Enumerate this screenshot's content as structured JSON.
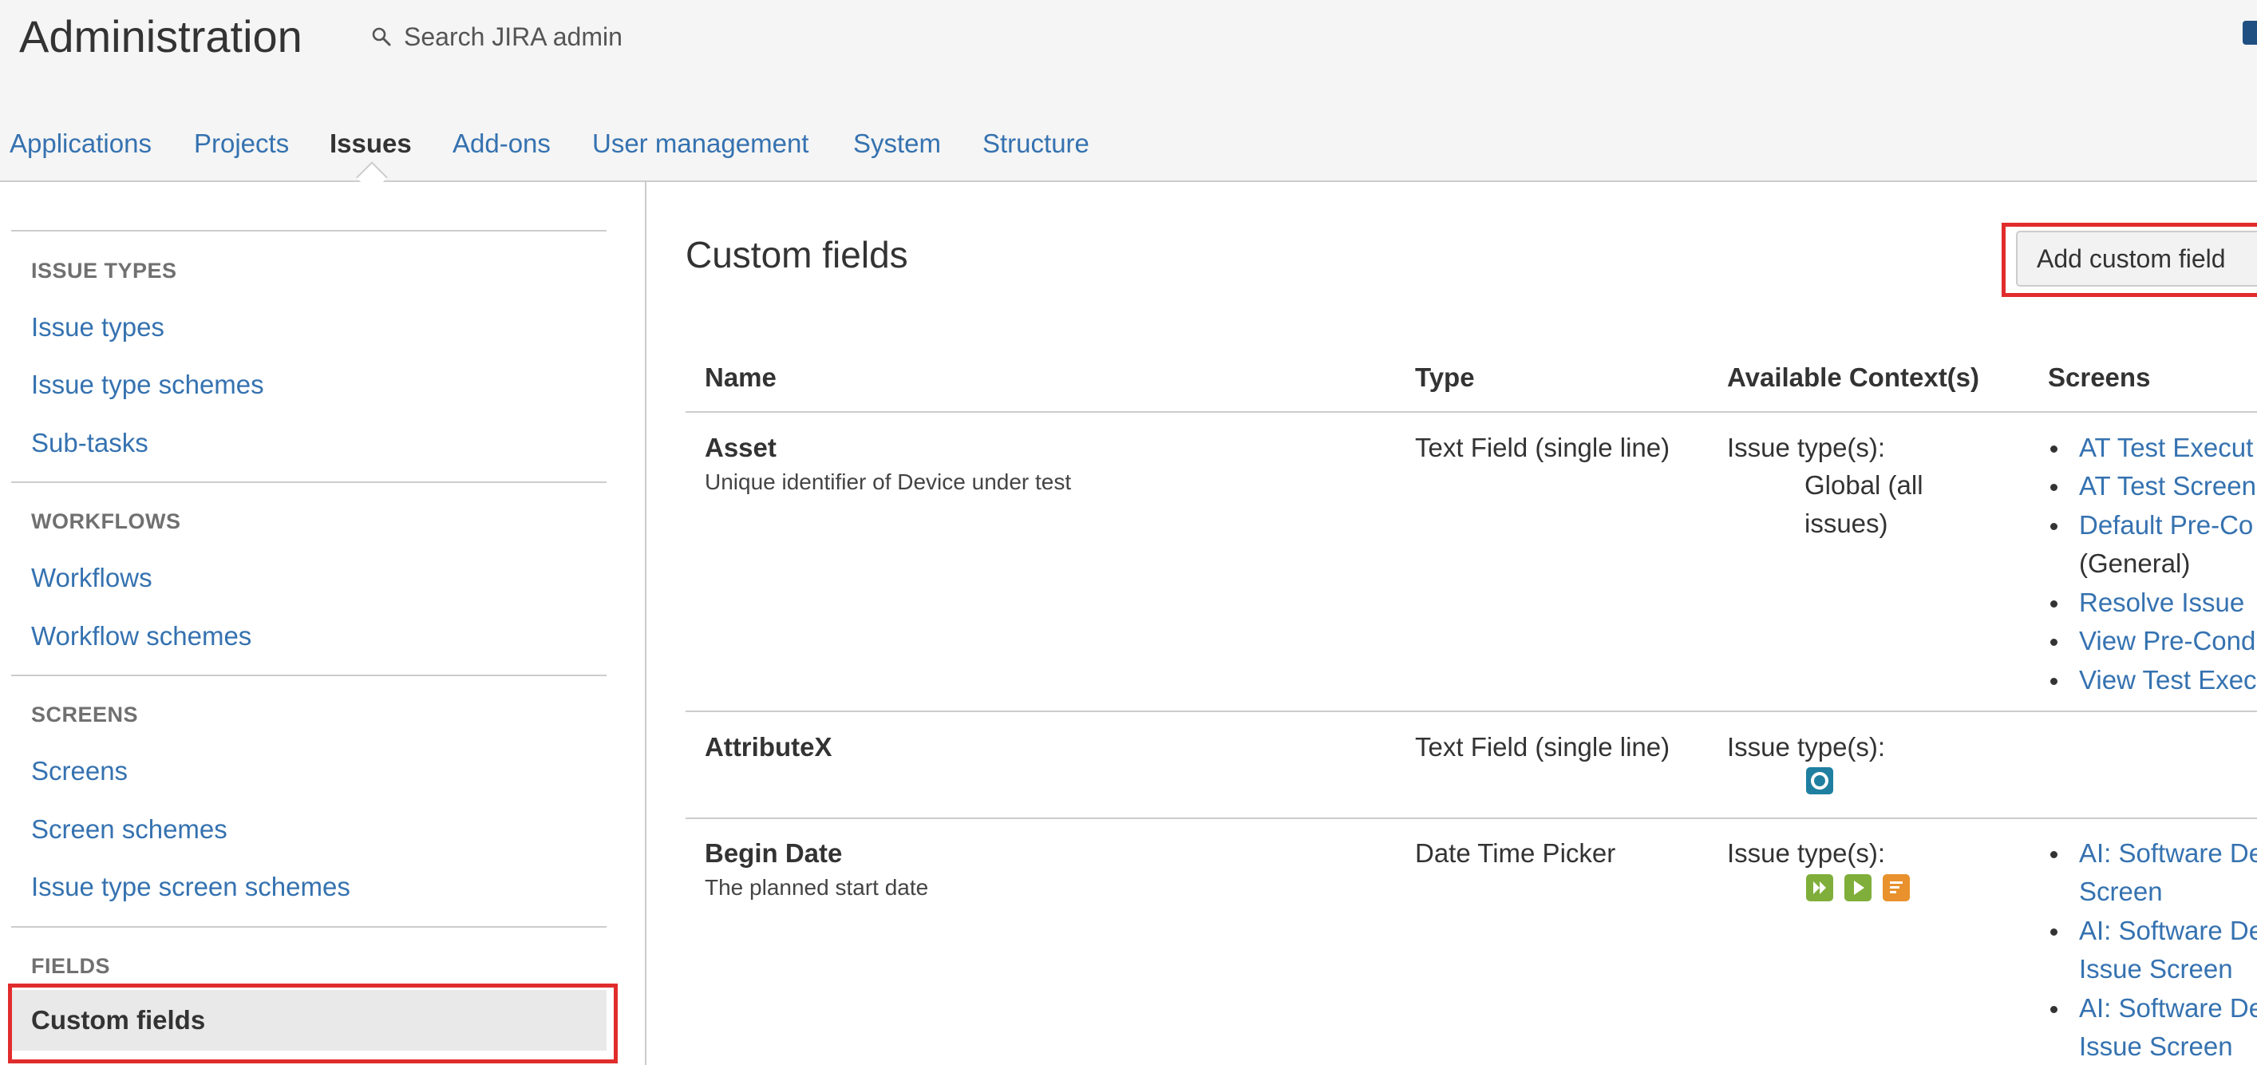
{
  "header": {
    "title": "Administration",
    "search_placeholder": "Search JIRA admin"
  },
  "nav": {
    "tabs": [
      "Applications",
      "Projects",
      "Issues",
      "Add-ons",
      "User management",
      "System",
      "Structure"
    ],
    "active": "Issues"
  },
  "sidebar": {
    "sections": [
      {
        "heading": "ISSUE TYPES",
        "items": [
          "Issue types",
          "Issue type schemes",
          "Sub-tasks"
        ]
      },
      {
        "heading": "WORKFLOWS",
        "items": [
          "Workflows",
          "Workflow schemes"
        ]
      },
      {
        "heading": "SCREENS",
        "items": [
          "Screens",
          "Screen schemes",
          "Issue type screen schemes"
        ]
      },
      {
        "heading": "FIELDS",
        "items": [
          "Custom fields"
        ]
      }
    ],
    "selected": "Custom fields"
  },
  "main": {
    "title": "Custom fields",
    "add_button": "Add custom field",
    "columns": [
      "Name",
      "Type",
      "Available Context(s)",
      "Screens"
    ],
    "rows": [
      {
        "name": "Asset",
        "description": "Unique identifier of Device under test",
        "type": "Text Field (single line)",
        "context_label": "Issue type(s):",
        "context_value_line1": "Global (all",
        "context_value_line2": "issues)",
        "screens": [
          "AT Test Execut",
          "AT Test Screen",
          "Default Pre-Co",
          "(General)",
          "Resolve Issue",
          "View Pre-Cond",
          "View Test Exec"
        ]
      },
      {
        "name": "AttributeX",
        "description": "",
        "type": "Text Field (single line)",
        "context_label": "Issue type(s):",
        "context_icons": [
          "test-execution-icon"
        ]
      },
      {
        "name": "Begin Date",
        "description": "The planned start date",
        "type": "Date Time Picker",
        "context_label": "Issue type(s):",
        "context_icons": [
          "test-plan-icon",
          "test-icon",
          "story-icon"
        ],
        "screens": [
          "AI: Software De",
          "Screen",
          "AI: Software De",
          "Issue Screen",
          "AI: Software De",
          "Issue Screen"
        ]
      }
    ]
  },
  "colors": {
    "link": "#3572b0",
    "highlight": "#e12c2c",
    "header_bg": "#f5f5f5"
  }
}
